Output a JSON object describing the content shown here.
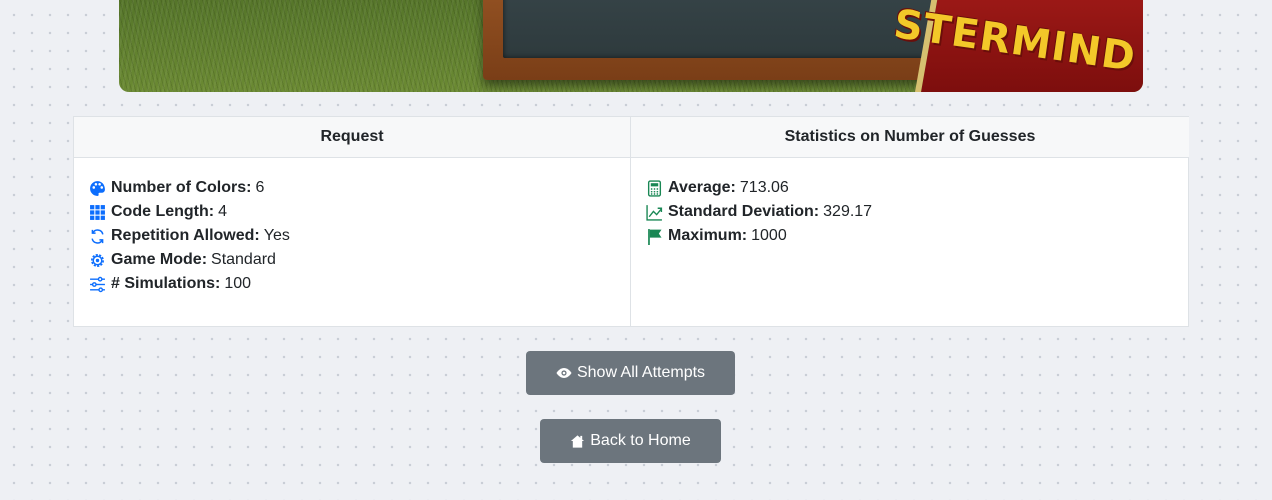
{
  "hero": {
    "box_text": "STERMIND"
  },
  "table": {
    "headers": [
      "Request",
      "Statistics on Number of Guesses"
    ],
    "request": [
      {
        "icon": "palette-icon",
        "label": "Number of Colors:",
        "value": "6"
      },
      {
        "icon": "grid-icon",
        "label": "Code Length:",
        "value": "4"
      },
      {
        "icon": "repeat-icon",
        "label": "Repetition Allowed:",
        "value": "Yes"
      },
      {
        "icon": "gear-icon",
        "label": "Game Mode:",
        "value": "Standard"
      },
      {
        "icon": "sliders-icon",
        "label": "# Simulations:",
        "value": "100"
      }
    ],
    "stats": [
      {
        "icon": "calculator-icon",
        "label": "Average:",
        "value": "713.06"
      },
      {
        "icon": "trend-up-icon",
        "label": "Standard Deviation:",
        "value": "329.17"
      },
      {
        "icon": "flag-icon",
        "label": "Maximum:",
        "value": "1000"
      }
    ]
  },
  "buttons": {
    "show_all": {
      "icon": "eye-icon",
      "label": "Show All Attempts"
    },
    "back_home": {
      "icon": "house-icon",
      "label": "Back to Home"
    }
  },
  "colors": {
    "request_icon": "#0d6efd",
    "stats_icon": "#198754",
    "button_bg": "#6c757d"
  }
}
